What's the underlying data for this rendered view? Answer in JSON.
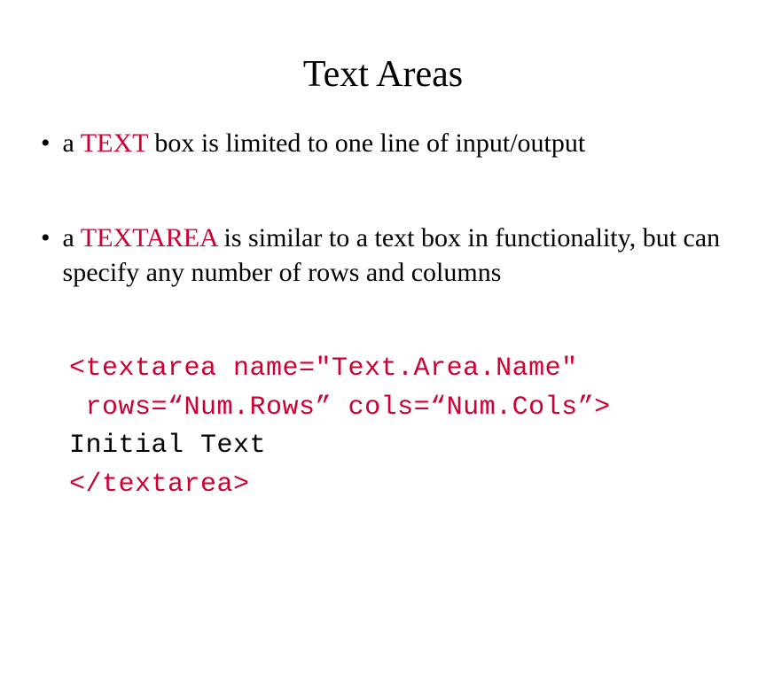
{
  "title": "Text Areas",
  "bullets": [
    {
      "prefix": "a ",
      "keyword": "TEXT",
      "rest": " box is limited to one line of input/output"
    },
    {
      "prefix": "a ",
      "keyword": "TEXTAREA",
      "rest": " is similar to a text box in functionality, but can specify any number of rows and columns"
    }
  ],
  "code": {
    "line1": "<textarea name=\"Text.Area.Name\"",
    "line2_indent": " ",
    "line2": "rows=“Num.Rows” cols=“Num.Cols”>",
    "line3": "Initial Text",
    "line4": "</textarea>"
  }
}
